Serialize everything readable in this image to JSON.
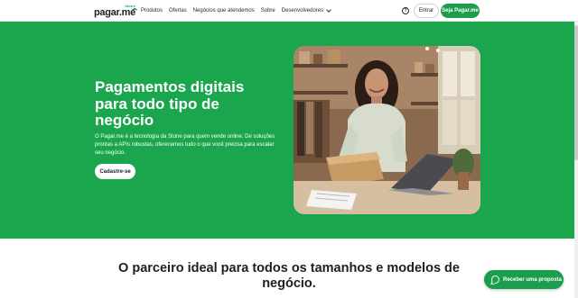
{
  "header": {
    "logo": {
      "brand": "pagar.me",
      "tag": "stone"
    },
    "nav": [
      {
        "label": "Produtos"
      },
      {
        "label": "Ofertas"
      },
      {
        "label": "Negócios que atendemos"
      },
      {
        "label": "Sobre"
      },
      {
        "label": "Desenvolvedores"
      }
    ],
    "help_icon": "?",
    "login_label": "Entrar",
    "signup_label": "Seja Pagar.me"
  },
  "hero": {
    "title": "Pagamentos digitais para todo tipo de negócio",
    "description": "O Pagar.me é a tecnologia da Stone para quem vende online. De soluções prontas a APIs robustas, oferecemos tudo o que você precisa para escalar seu negócio.",
    "cta_label": "Cadastre-se"
  },
  "section": {
    "title": "O parceiro ideal para todos os tamanhos e modelos de negócio."
  },
  "floating": {
    "whatsapp_label": "Receber uma proposta"
  },
  "colors": {
    "brand_green": "#1ba64e",
    "button_green": "#1a9e4b"
  }
}
